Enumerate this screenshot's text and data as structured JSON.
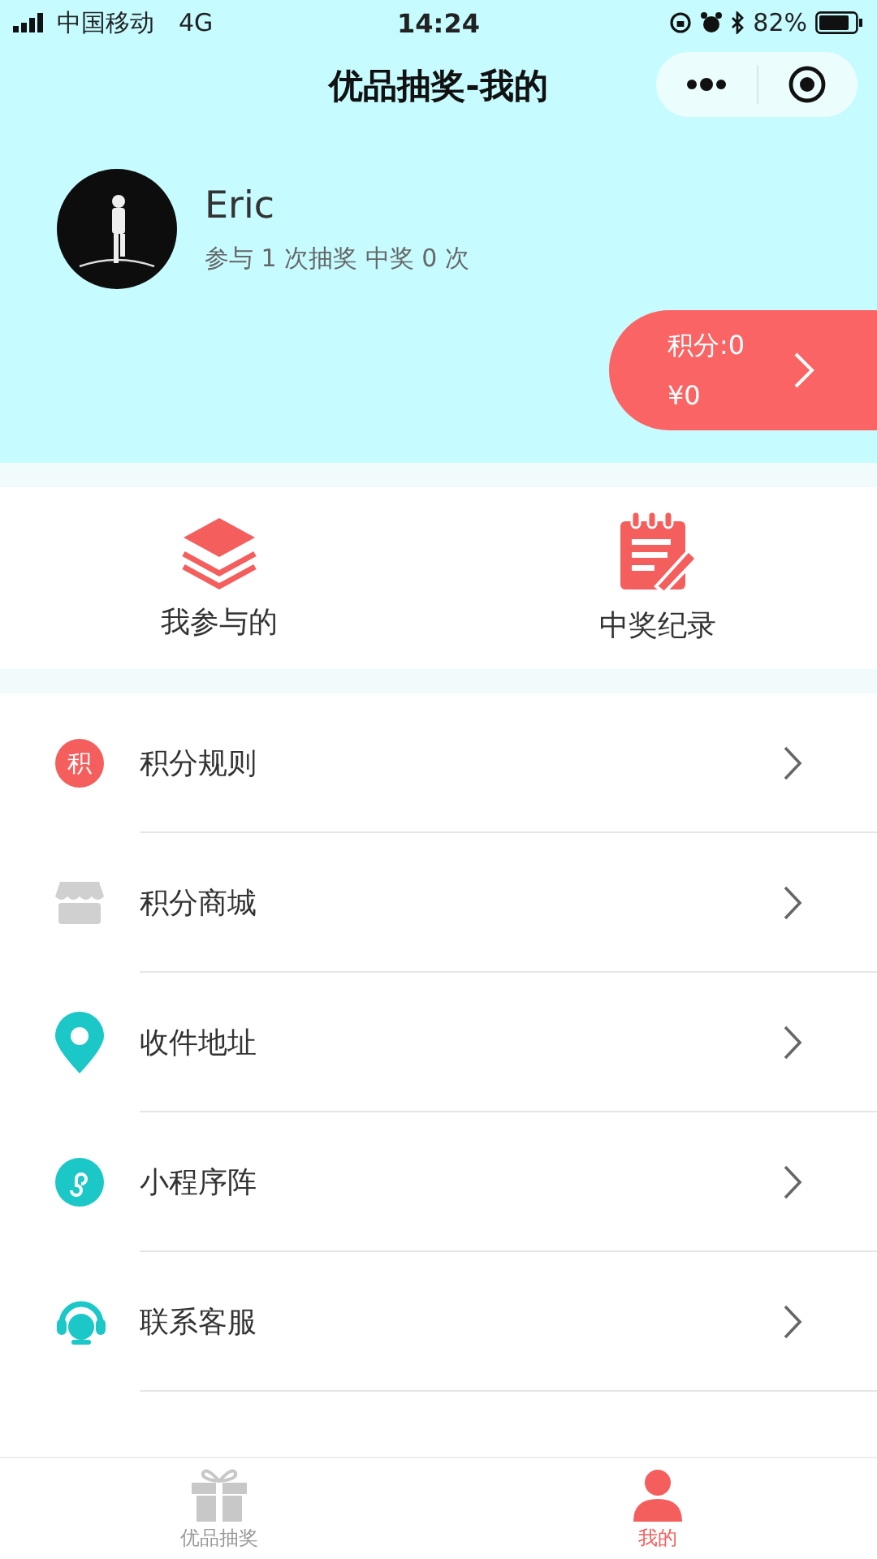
{
  "status_bar": {
    "carrier": "中国移动",
    "network": "4G",
    "time": "14:24",
    "battery": "82%"
  },
  "nav_bar": {
    "title": "优品抽奖-我的"
  },
  "profile": {
    "name": "Eric",
    "summary": "参与 1 次抽奖 中奖 0 次"
  },
  "points_card": {
    "points": "积分:0",
    "money": "¥0"
  },
  "shortcuts": [
    {
      "kind": "layers",
      "label": "我参与的"
    },
    {
      "kind": "notepad",
      "label": "中奖纪录"
    }
  ],
  "menu": [
    {
      "kind": "badge",
      "badge": "积",
      "label": "积分规则"
    },
    {
      "kind": "shop",
      "label": "积分商城"
    },
    {
      "kind": "pin",
      "label": "收件地址"
    },
    {
      "kind": "mini",
      "label": "小程序阵"
    },
    {
      "kind": "headset",
      "label": "联系客服"
    }
  ],
  "tab_bar": [
    {
      "kind": "gift",
      "label": "优品抽奖",
      "selected": false
    },
    {
      "kind": "person",
      "label": "我的",
      "selected": true
    }
  ]
}
